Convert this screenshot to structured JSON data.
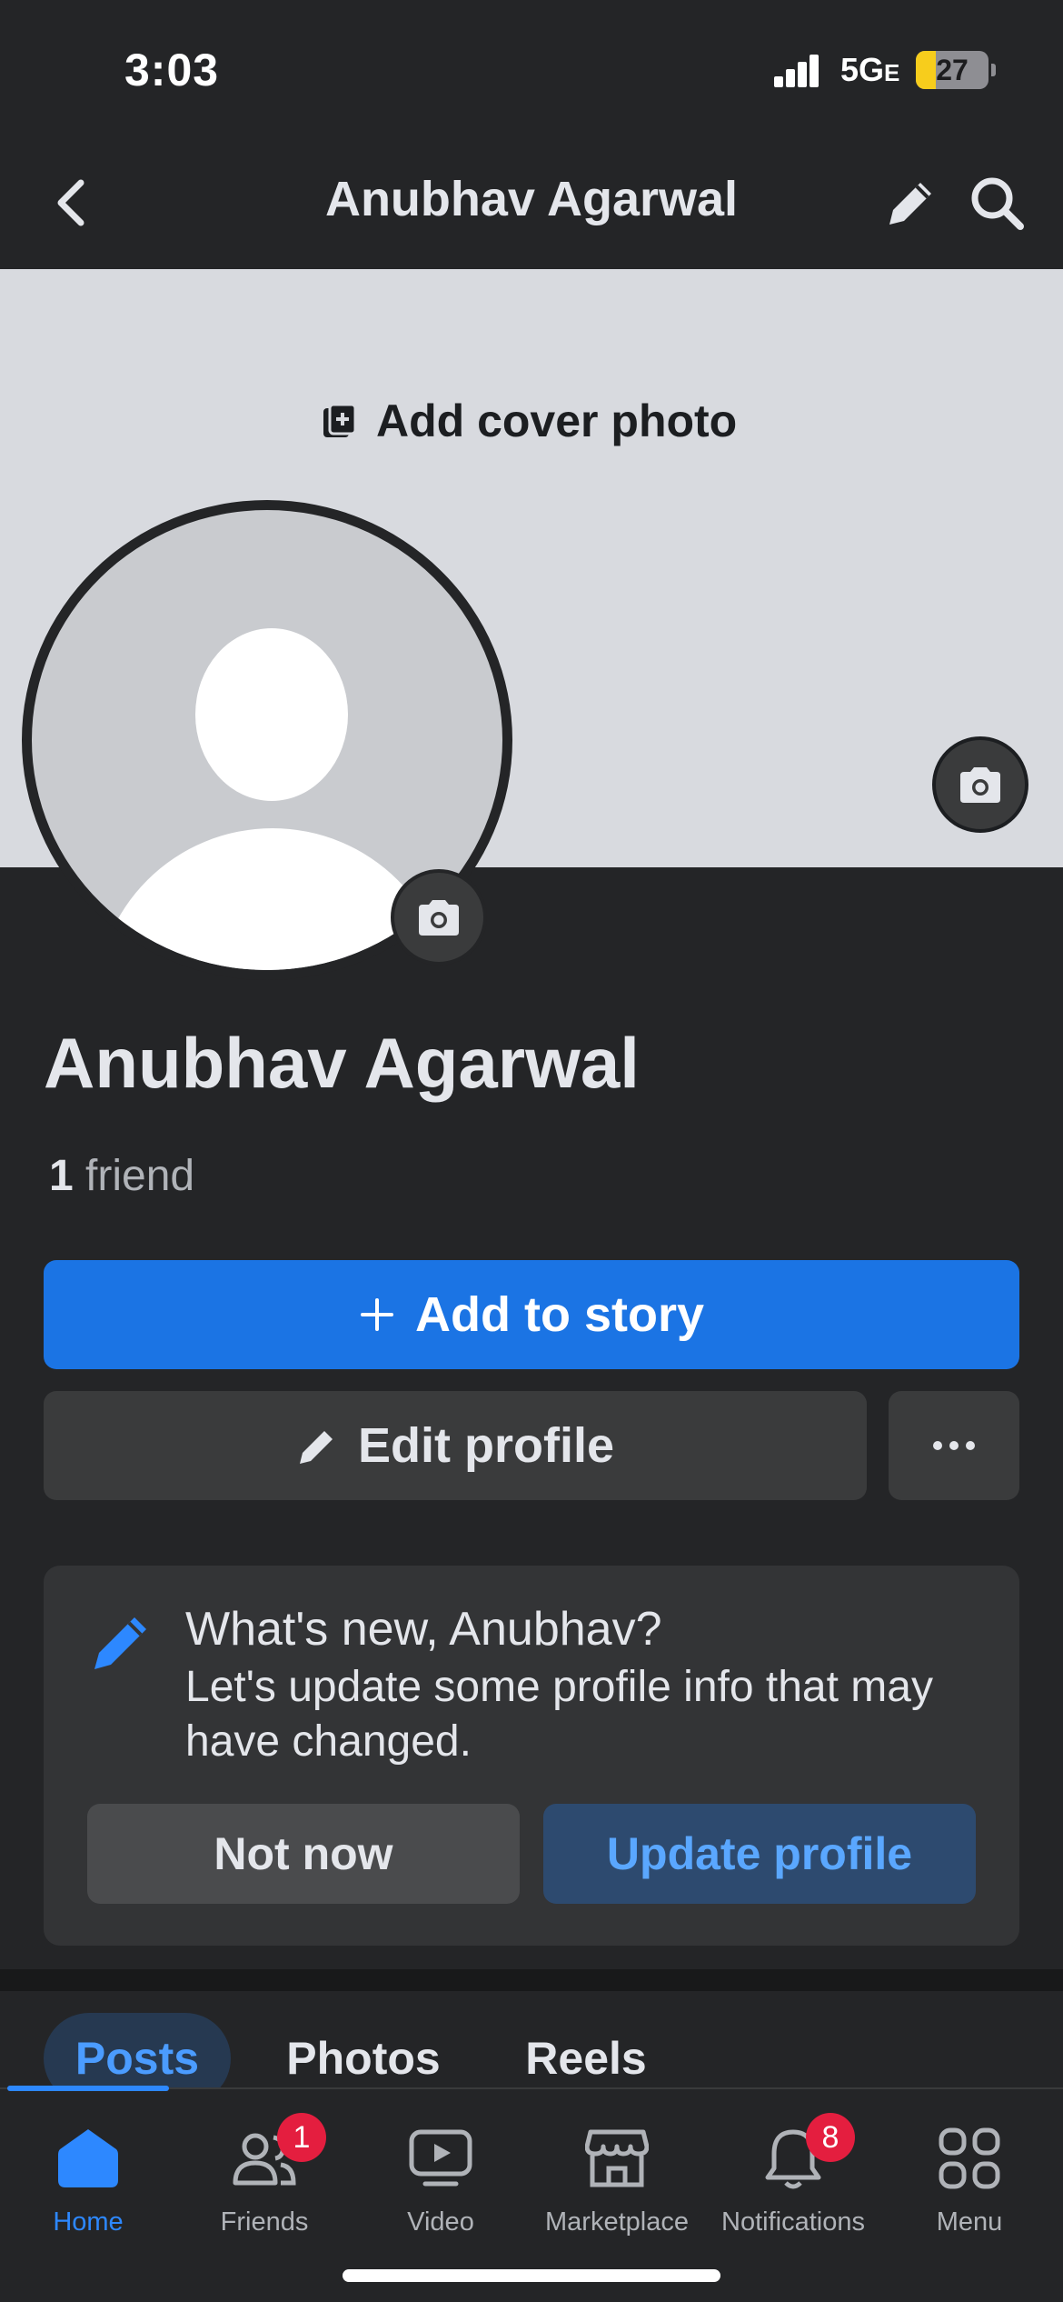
{
  "status_bar": {
    "time": "3:03",
    "network": "5G",
    "network_suffix": "E",
    "battery": "27"
  },
  "header": {
    "title": "Anubhav Agarwal",
    "back_icon": "chevron-left-icon",
    "edit_icon": "pencil-icon",
    "search_icon": "search-icon"
  },
  "cover": {
    "add_cover_label": "Add cover photo"
  },
  "profile": {
    "name": "Anubhav Agarwal",
    "friend_count": "1",
    "friend_word": "friend"
  },
  "actions": {
    "add_story": "Add to story",
    "edit_profile": "Edit profile"
  },
  "update_card": {
    "title": "What's new, Anubhav?",
    "description": "Let's update some profile info that may have changed.",
    "not_now": "Not now",
    "update_profile": "Update profile"
  },
  "tabs": [
    {
      "label": "Posts",
      "active": true
    },
    {
      "label": "Photos",
      "active": false
    },
    {
      "label": "Reels",
      "active": false
    }
  ],
  "bottom_nav": [
    {
      "label": "Home",
      "icon": "home-icon",
      "active": true
    },
    {
      "label": "Friends",
      "icon": "friends-icon",
      "badge": "1"
    },
    {
      "label": "Video",
      "icon": "video-icon"
    },
    {
      "label": "Marketplace",
      "icon": "marketplace-icon"
    },
    {
      "label": "Notifications",
      "icon": "bell-icon",
      "badge": "8"
    },
    {
      "label": "Menu",
      "icon": "menu-grid-icon"
    }
  ],
  "colors": {
    "accent": "#1b74e4",
    "badge": "#e41e3f",
    "background": "#242527"
  }
}
